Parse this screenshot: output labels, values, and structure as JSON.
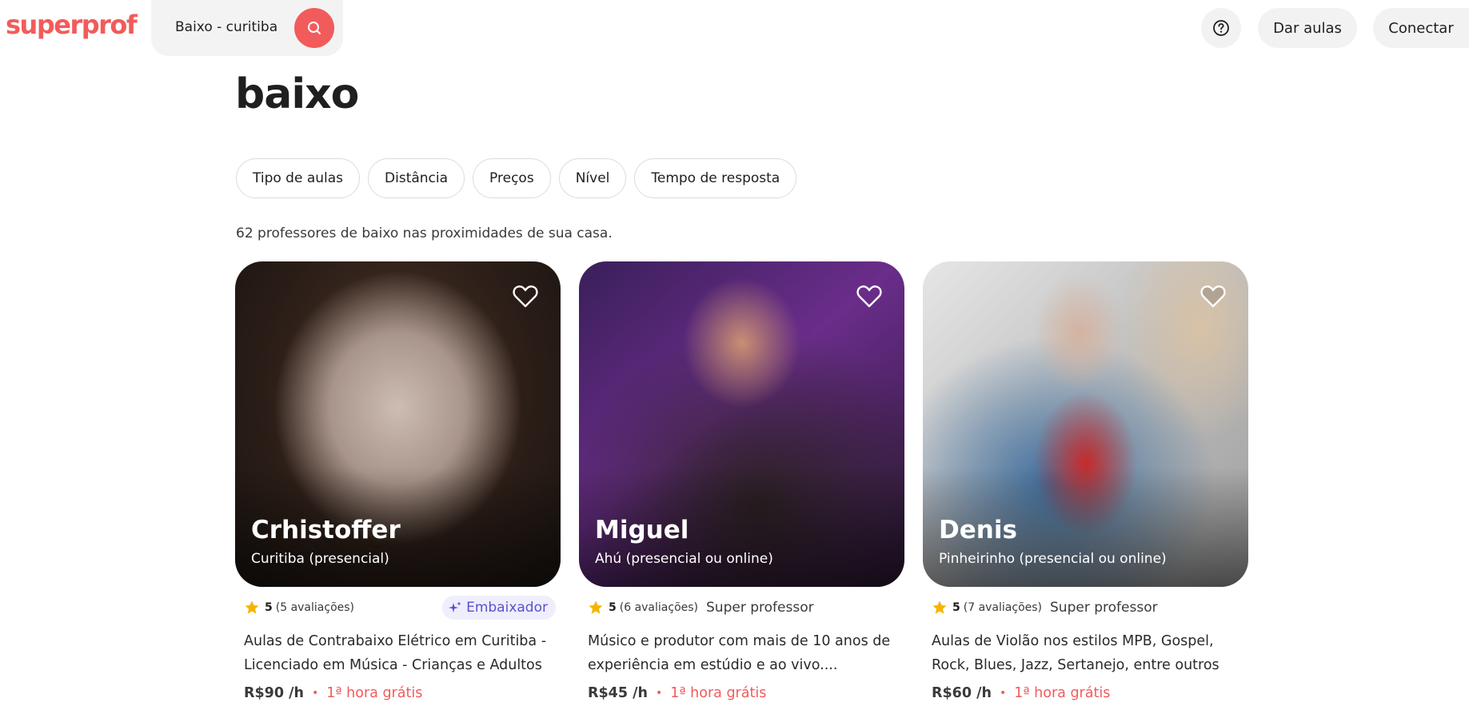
{
  "header": {
    "logo": "superprof",
    "search_value": "Baixo - curitiba",
    "dar_aulas": "Dar aulas",
    "conectar": "Conectar"
  },
  "page": {
    "title": "baixo",
    "result_count": "62 professores de baixo nas proximidades de sua casa."
  },
  "filters": [
    "Tipo de aulas",
    "Distância",
    "Preços",
    "Nível",
    "Tempo de resposta"
  ],
  "teachers": [
    {
      "name": "Crhistoffer",
      "location": "Curitiba (presencial)",
      "rating": "5",
      "reviews": "(5 avaliações)",
      "badge": "Embaixador",
      "desc_line1": "Aulas de Contrabaixo Elétrico em Curitiba -",
      "desc_line2": "Licenciado em Música - Crianças e Adultos",
      "price": "R$90 /h",
      "free": "1ª hora grátis"
    },
    {
      "name": "Miguel",
      "location": "Ahú (presencial ou online)",
      "rating": "5",
      "reviews": "(6 avaliações)",
      "badge": "Super professor",
      "desc_line1": "Músico e produtor com mais de 10 anos de",
      "desc_line2": "experiência em estúdio e ao vivo....",
      "price": "R$45 /h",
      "free": "1ª hora grátis"
    },
    {
      "name": "Denis",
      "location": "Pinheirinho (presencial ou online)",
      "rating": "5",
      "reviews": "(7 avaliações)",
      "badge": "Super professor",
      "desc_line1": "Aulas de Violão nos estilos MPB, Gospel,",
      "desc_line2": "Rock, Blues, Jazz, Sertanejo, entre outros",
      "price": "R$60 /h",
      "free": "1ª hora grátis"
    }
  ],
  "icons": {
    "search": "search-icon",
    "help": "help-circle-icon",
    "favorite": "heart-icon",
    "star": "star-icon",
    "sparkle": "sparkle-icon"
  },
  "colors": {
    "brand": "#f25b5b",
    "ambassador": "#5b4fd1",
    "star": "#f5b400"
  }
}
